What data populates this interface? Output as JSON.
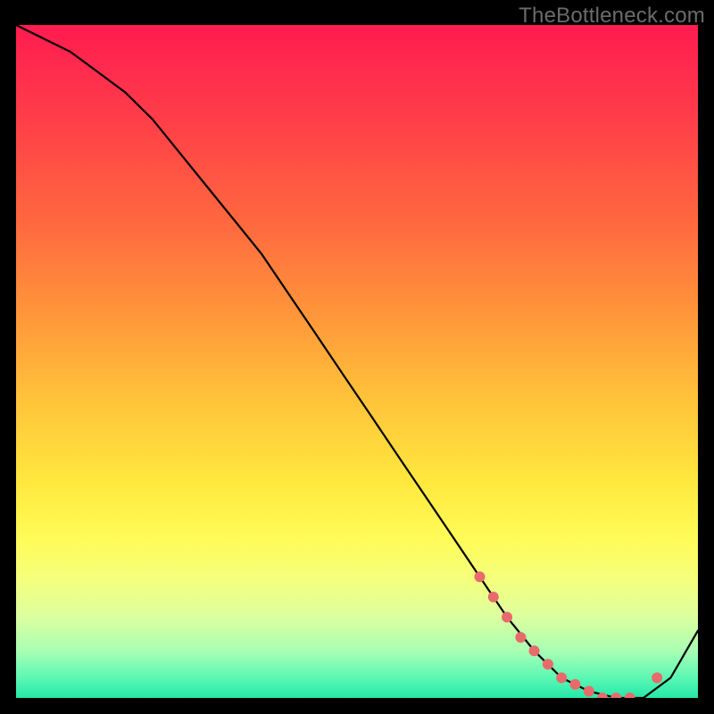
{
  "watermark": "TheBottleneck.com",
  "chart_data": {
    "type": "line",
    "title": "",
    "xlabel": "",
    "ylabel": "",
    "xlim": [
      0,
      100
    ],
    "ylim": [
      0,
      100
    ],
    "series": [
      {
        "name": "bottleneck-curve",
        "x": [
          0,
          4,
          8,
          12,
          16,
          20,
          24,
          28,
          32,
          36,
          40,
          44,
          48,
          52,
          56,
          60,
          64,
          68,
          72,
          76,
          80,
          84,
          88,
          92,
          96,
          100
        ],
        "y": [
          100,
          98,
          96,
          93,
          90,
          86,
          81,
          76,
          71,
          66,
          60,
          54,
          48,
          42,
          36,
          30,
          24,
          18,
          12,
          7,
          3,
          1,
          0,
          0,
          3,
          10
        ]
      }
    ],
    "markers": {
      "name": "highlight-points",
      "color": "#e86b6b",
      "x": [
        68,
        70,
        72,
        74,
        76,
        78,
        80,
        82,
        84,
        86,
        88,
        90,
        94
      ],
      "y": [
        18,
        15,
        12,
        9,
        7,
        5,
        3,
        2,
        1,
        0,
        0,
        0,
        3
      ]
    },
    "gradient_stops": [
      {
        "pos": 0.0,
        "color": "#ff1b4f"
      },
      {
        "pos": 0.3,
        "color": "#ff6a3f"
      },
      {
        "pos": 0.56,
        "color": "#ffc43a"
      },
      {
        "pos": 0.76,
        "color": "#fffb57"
      },
      {
        "pos": 0.93,
        "color": "#a8ffb3"
      },
      {
        "pos": 1.0,
        "color": "#24e8a9"
      }
    ]
  }
}
